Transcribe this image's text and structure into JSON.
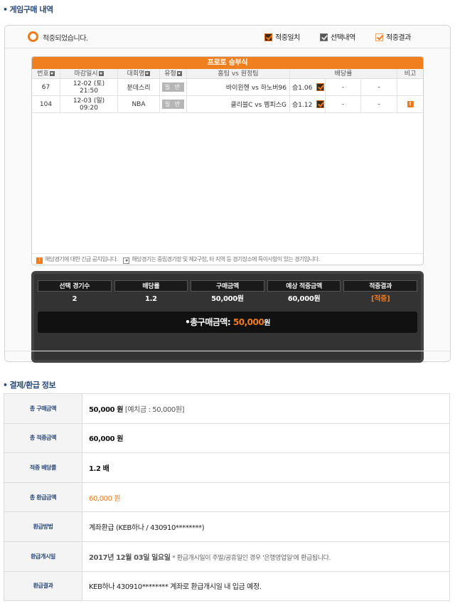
{
  "section1": {
    "title": "게임구매 내역"
  },
  "status": {
    "text": "적중되었습니다."
  },
  "legend": {
    "hit": "적중일치",
    "selected": "선택내역",
    "result": "적중결과"
  },
  "grid": {
    "title": "프로토 승부식",
    "headers": [
      "번호",
      "마감일시",
      "대회명",
      "유형",
      "홈팀 vs 원정팀",
      "배당률",
      "비고"
    ],
    "rows": [
      {
        "no": "67",
        "date": "12-02 (토)",
        "time": "21:50",
        "league": "분데스리",
        "type": "일 반",
        "match": "바이윈헨 vs 하노버96",
        "odds": "승1.06",
        "draw": "-",
        "lose": "-",
        "note": ""
      },
      {
        "no": "104",
        "date": "12-03 (일)",
        "time": "09:20",
        "league": "NBA",
        "type": "일 반",
        "match": "클리블C vs 멤피스G",
        "odds": "승1.12",
        "draw": "-",
        "lose": "-",
        "note": "!"
      }
    ],
    "footer_notice": "해당경기에 대한 긴급 공지입니다.",
    "footer_star": "해당경기는 중립경기장 및 제2구장, 타 지역 등 경기장소에 특이사항이 있는 경기입니다."
  },
  "summary": {
    "headers": [
      "선택 경기수",
      "배당률",
      "구매금액",
      "예상 적중금액",
      "적중결과"
    ],
    "values": [
      "2",
      "1.2",
      "50,000원",
      "60,000원",
      "[적중]"
    ],
    "total_label": "총구매금액:",
    "total_amount": "50,000",
    "total_unit": "원"
  },
  "section2": {
    "title": "결제/환급 정보"
  },
  "payment": {
    "purchase_label": "총 구매금액",
    "purchase_value": "50,000 원",
    "purchase_deposit": "[예치금 : 50,000원]",
    "win_label": "총 적중금액",
    "win_value": "60,000 원",
    "odds_label": "적중 배당률",
    "odds_value": "1.2 배",
    "refund_label": "총 환급금액",
    "refund_value": "60,000 원",
    "method_label": "환급방법",
    "method_value": "계좌환급 (KEB하나 / 430910********)",
    "start_label": "환급개시일",
    "start_value": "2017년 12월 03일 일요일",
    "start_note": "* 환급개시일이 주말/공휴일인 경우 '은행영업일'에 환급됩니다.",
    "result_label": "환급결과",
    "result_value": "KEB하나 430910******** 계좌로 환급개시일 내 입금 예정."
  },
  "colors": {
    "accent": "#f07a1c",
    "heading": "#2a4a7a",
    "dark": "#333333"
  }
}
